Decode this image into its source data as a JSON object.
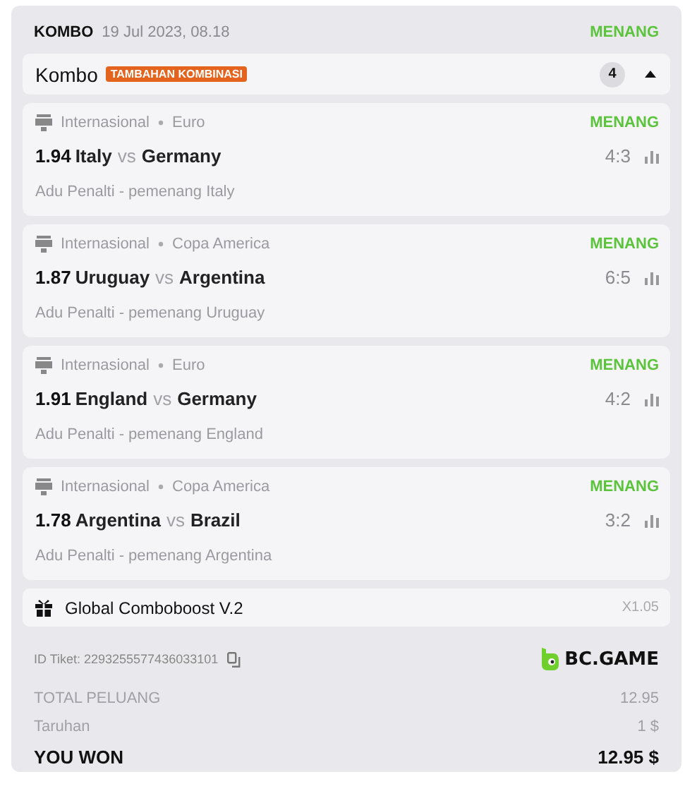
{
  "header": {
    "type": "KOMBO",
    "date": "19 Jul 2023, 08.18",
    "status": "MENANG"
  },
  "combo": {
    "title": "Kombo",
    "tag": "TAMBAHAN KOMBINASI",
    "count": "4",
    "expanded": true
  },
  "bets": [
    {
      "league": "Internasional",
      "tournament": "Euro",
      "status": "MENANG",
      "odds": "1.94",
      "home": "Italy",
      "vs": "vs",
      "away": "Germany",
      "score": "4:3",
      "market": "Adu Penalti - pemenang Italy"
    },
    {
      "league": "Internasional",
      "tournament": "Copa America",
      "status": "MENANG",
      "odds": "1.87",
      "home": "Uruguay",
      "vs": "vs",
      "away": "Argentina",
      "score": "6:5",
      "market": "Adu Penalti - pemenang Uruguay"
    },
    {
      "league": "Internasional",
      "tournament": "Euro",
      "status": "MENANG",
      "odds": "1.91",
      "home": "England",
      "vs": "vs",
      "away": "Germany",
      "score": "4:2",
      "market": "Adu Penalti - pemenang England"
    },
    {
      "league": "Internasional",
      "tournament": "Copa America",
      "status": "MENANG",
      "odds": "1.78",
      "home": "Argentina",
      "vs": "vs",
      "away": "Brazil",
      "score": "3:2",
      "market": "Adu Penalti - pemenang Argentina"
    }
  ],
  "boost": {
    "name": "Global Comboboost V.2",
    "multiplier": "X1.05"
  },
  "ticket": {
    "id": "ID Tiket: 2293255577436033101",
    "brand": "BC.GAME"
  },
  "totals": [
    {
      "kind": "muted",
      "label": "TOTAL PELUANG",
      "value": "12.95"
    },
    {
      "kind": "muted",
      "label": "Taruhan",
      "value": "1 $"
    },
    {
      "kind": "strong",
      "label": "YOU WON",
      "value": "12.95 $"
    }
  ]
}
